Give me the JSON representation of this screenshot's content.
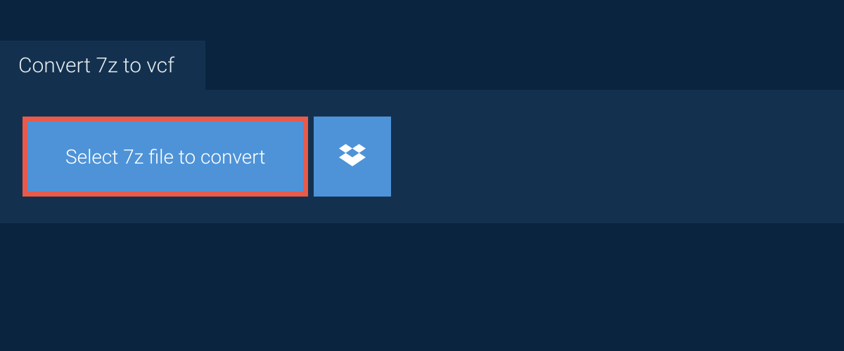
{
  "tab": {
    "title": "Convert 7z to vcf"
  },
  "actions": {
    "select_label": "Select 7z file to convert"
  },
  "colors": {
    "background": "#0a2440",
    "panel": "#13314f",
    "button": "#4e93d8",
    "highlight": "#e85a4a",
    "text": "#e8edf2"
  }
}
